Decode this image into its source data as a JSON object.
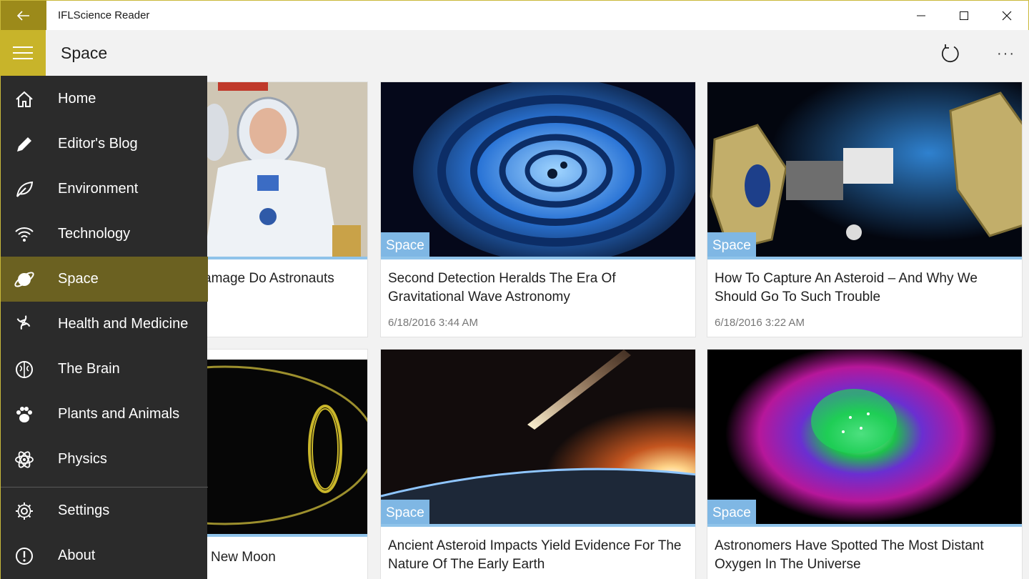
{
  "window": {
    "title": "IFLScience Reader",
    "accent_color": "#c8b42a",
    "back_color": "#9c8a1a"
  },
  "header": {
    "title": "Space",
    "more_label": "···"
  },
  "drawer": {
    "items": [
      {
        "label": "Home",
        "icon": "home-icon"
      },
      {
        "label": "Editor's Blog",
        "icon": "pencil-icon"
      },
      {
        "label": "Environment",
        "icon": "leaf-icon"
      },
      {
        "label": "Technology",
        "icon": "wifi-icon"
      },
      {
        "label": "Space",
        "icon": "planet-icon",
        "active": true
      },
      {
        "label": "Health and Medicine",
        "icon": "dna-icon"
      },
      {
        "label": "The Brain",
        "icon": "brain-icon"
      },
      {
        "label": "Plants and Animals",
        "icon": "paw-icon"
      },
      {
        "label": "Physics",
        "icon": "atom-icon"
      }
    ],
    "footer_items": [
      {
        "label": "Settings",
        "icon": "gear-icon"
      },
      {
        "label": "About",
        "icon": "info-icon"
      }
    ]
  },
  "cards": [
    {
      "title_visible": "amage Do Astronauts",
      "image": "astronauts-photo"
    },
    {
      "tag": "Space",
      "title": "Second Detection Heralds The Era Of Gravitational Wave Astronomy",
      "date": "6/18/2016 3:44 AM",
      "image": "gravitational-wave-spiral"
    },
    {
      "tag": "Space",
      "title": "How To Capture An Asteroid – And Why We Should Go To Such Trouble",
      "date": "6/18/2016 3:22 AM",
      "image": "asteroid-capture-spacecraft"
    },
    {
      "title_visible": "New Moon",
      "image": "orbit-diagram"
    },
    {
      "tag": "Space",
      "title": "Ancient Asteroid Impacts Yield Evidence For The Nature Of The Early Earth",
      "image": "meteor-over-earth"
    },
    {
      "tag": "Space",
      "title": "Astronomers Have Spotted The Most Distant Oxygen In The Universe",
      "image": "distant-galaxy-nebula"
    }
  ]
}
